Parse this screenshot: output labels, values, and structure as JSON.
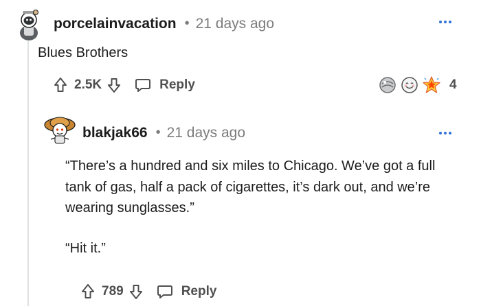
{
  "comments": [
    {
      "username": "porcelainvacation",
      "separator": "•",
      "time": "21 days ago",
      "body": "Blues Brothers",
      "votes": "2.5K",
      "reply_label": "Reply",
      "awards": {
        "icons": [
          "silver-award-icon",
          "wholesome-award-icon",
          "star-struck-award-icon"
        ],
        "count": "4"
      }
    },
    {
      "username": "blakjak66",
      "separator": "•",
      "time": "21 days ago",
      "body_paragraphs": [
        "“There’s a hundred and six miles to Chicago. We’ve got a full tank of gas, half a pack of cigarettes, it’s dark out, and we’re wearing sunglasses.”",
        "“Hit it.”"
      ],
      "votes": "789",
      "reply_label": "Reply"
    }
  ]
}
